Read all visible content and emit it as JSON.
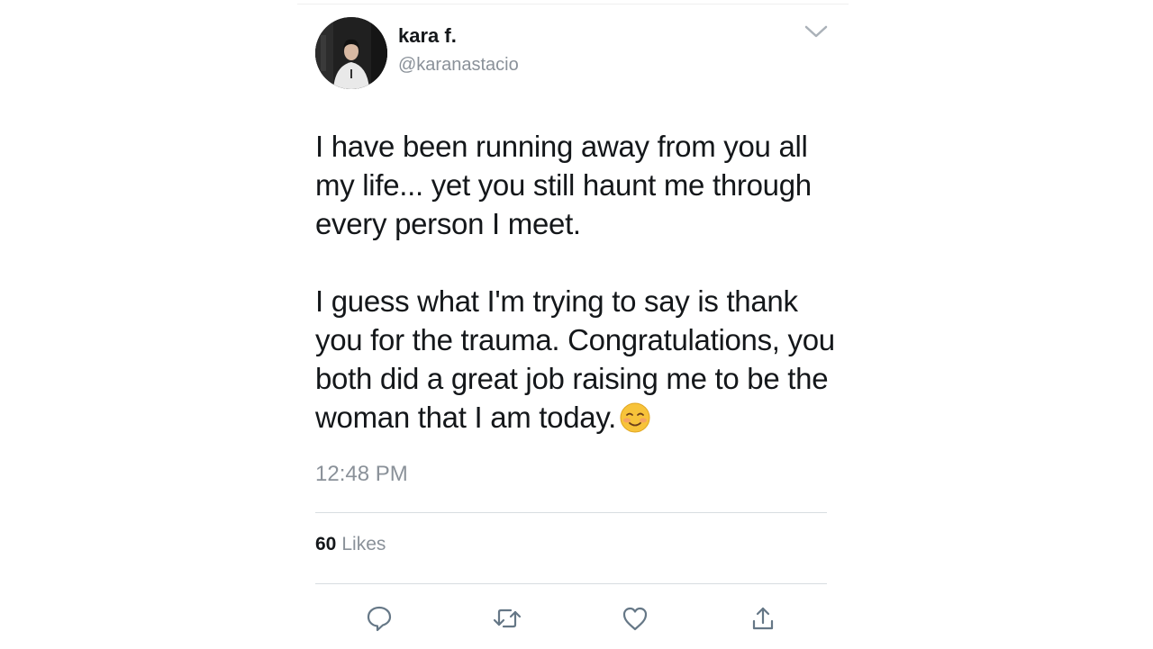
{
  "user": {
    "name": "kara f.",
    "handle": "@karanastacio"
  },
  "tweet": {
    "paragraph1": "I have been running away from you all my life... yet you still haunt me through every person I meet.",
    "paragraph2": "I guess what I'm trying to say is thank you for the trauma. Congratulations, you both did a great job raising me to be the woman that I am today.",
    "emoji": "smiling-face-icon",
    "time": "12:48 PM"
  },
  "stats": {
    "likes_count": "60",
    "likes_label": "Likes"
  },
  "icons": {
    "menu": "chevron-down-icon",
    "reply": "reply-icon",
    "retweet": "retweet-icon",
    "like": "heart-icon",
    "share": "share-icon"
  },
  "colors": {
    "text": "#14171a",
    "muted": "#8a9199",
    "icon": "#657786",
    "divider": "#d8dde1"
  }
}
